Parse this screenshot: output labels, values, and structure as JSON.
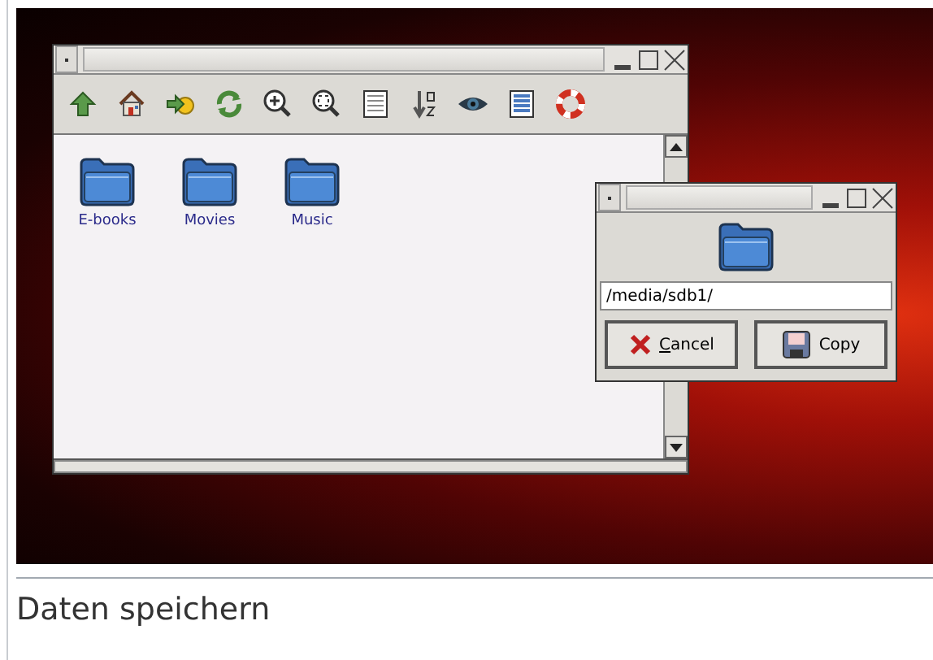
{
  "file_manager": {
    "folders": [
      {
        "label": "E-books"
      },
      {
        "label": "Movies"
      },
      {
        "label": "Music"
      }
    ]
  },
  "copy_dialog": {
    "path": "/media/sdb1/",
    "buttons": [
      {
        "kind": "cancel",
        "label": "Cancel",
        "mnemonic": true
      },
      {
        "kind": "copy",
        "label": "Copy",
        "mnemonic": false
      }
    ]
  },
  "caption": "Daten speichern"
}
